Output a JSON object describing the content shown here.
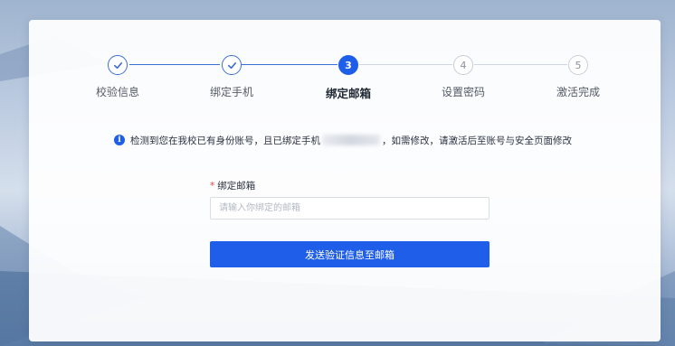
{
  "steps": [
    {
      "number": "1",
      "label": "校验信息",
      "status": "done"
    },
    {
      "number": "2",
      "label": "绑定手机",
      "status": "done"
    },
    {
      "number": "3",
      "label": "绑定邮箱",
      "status": "active"
    },
    {
      "number": "4",
      "label": "设置密码",
      "status": "pending"
    },
    {
      "number": "5",
      "label": "激活完成",
      "status": "pending"
    }
  ],
  "notice": {
    "icon": "info-icon",
    "prefix": "检测到您在我校已有身份账号，且已绑定手机",
    "suffix": "，如需修改，请激活后至账号与安全页面修改"
  },
  "form": {
    "required_mark": "*",
    "email_label": "绑定邮箱",
    "email_placeholder": "请输入你绑定的邮箱",
    "email_value": "",
    "submit_label": "发送验证信息至邮箱"
  },
  "colors": {
    "primary": "#1f5ee8",
    "required": "#e34545"
  }
}
